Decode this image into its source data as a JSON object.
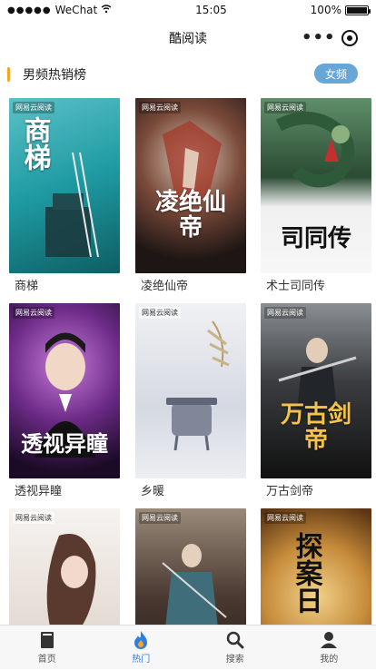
{
  "status_bar": {
    "carrier": "WeChat",
    "time": "15:05",
    "battery": "100%"
  },
  "nav": {
    "title": "酷阅读"
  },
  "section": {
    "title": "男频热销榜",
    "toggle_label": "女频"
  },
  "books": [
    {
      "title": "商梯",
      "cover_text": "商梯",
      "cover_bg": "#1aa0a6"
    },
    {
      "title": "凌绝仙帝",
      "cover_text": "凌绝仙帝",
      "cover_bg": "#3a2d2a"
    },
    {
      "title": "术士司同传",
      "cover_text": "司同传",
      "cover_bg": "#2d4a30"
    },
    {
      "title": "透视异瞳",
      "cover_text": "透视异瞳",
      "cover_bg": "#4a1f5e"
    },
    {
      "title": "乡暖",
      "cover_text": "",
      "cover_bg": "#d9dde6"
    },
    {
      "title": "万古剑帝",
      "cover_text": "万古剑帝",
      "cover_bg": "#2a2a2a"
    },
    {
      "title": "",
      "cover_text": "",
      "cover_bg": "#e8e3de"
    },
    {
      "title": "",
      "cover_text": "",
      "cover_bg": "#2f2622"
    },
    {
      "title": "",
      "cover_text": "探案日",
      "cover_bg": "#b0772b"
    }
  ],
  "tabs": [
    {
      "label": "首页",
      "icon": "book-icon"
    },
    {
      "label": "热门",
      "icon": "flame-icon"
    },
    {
      "label": "搜索",
      "icon": "search-icon"
    },
    {
      "label": "我的",
      "icon": "user-icon"
    }
  ],
  "colors": {
    "accent": "#f5a623",
    "toggle_bg": "#67a7d8",
    "tab_active": "#2f7ee0"
  }
}
